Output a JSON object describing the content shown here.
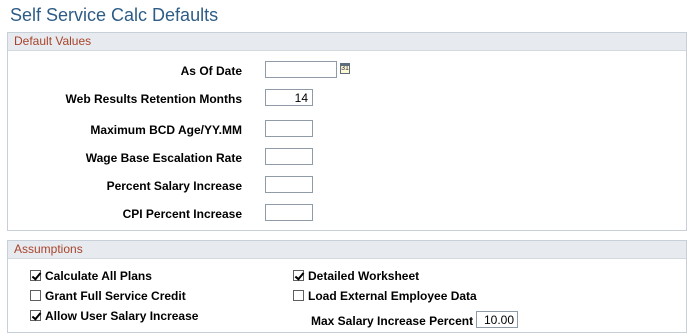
{
  "page": {
    "title": "Self Service Calc Defaults"
  },
  "default_values": {
    "header": "Default Values",
    "as_of_date": {
      "label": "As Of Date",
      "value": ""
    },
    "calendar_icon": "calendar-icon",
    "retention_months": {
      "label": "Web Results Retention Months",
      "value": "14"
    },
    "max_bcd_age": {
      "label": "Maximum BCD Age/YY.MM",
      "value": ""
    },
    "wage_base_rate": {
      "label": "Wage Base Escalation Rate",
      "value": ""
    },
    "percent_salary_increase": {
      "label": "Percent Salary Increase",
      "value": ""
    },
    "cpi_percent_increase": {
      "label": "CPI Percent Increase",
      "value": ""
    }
  },
  "assumptions": {
    "header": "Assumptions",
    "calculate_all_plans": {
      "label": "Calculate All Plans",
      "checked": true
    },
    "grant_full_service_credit": {
      "label": "Grant Full Service Credit",
      "checked": false
    },
    "allow_user_salary_increase": {
      "label": "Allow User Salary Increase",
      "checked": true
    },
    "detailed_worksheet": {
      "label": "Detailed Worksheet",
      "checked": true
    },
    "load_external_employee_data": {
      "label": "Load External Employee Data",
      "checked": false
    },
    "max_salary_increase_percent": {
      "label": "Max Salary Increase Percent",
      "value": "10.00"
    }
  }
}
